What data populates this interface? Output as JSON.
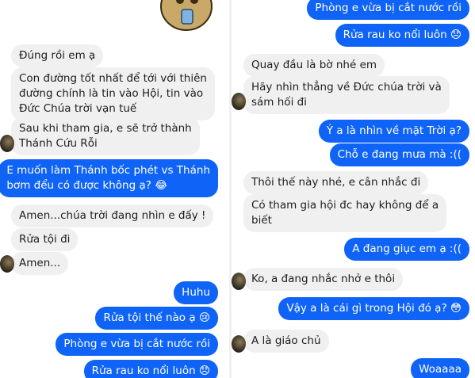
{
  "left": {
    "messages": [
      {
        "side": "in",
        "text": "Đúng rồi em ạ"
      },
      {
        "side": "in",
        "lines": [
          "Con đường tốt nhất để tới với thiên",
          "đường chính là tin vào Hội, tin vào",
          "Đức Chúa trời vạn tuế"
        ]
      },
      {
        "side": "in",
        "lines": [
          "Sau khi tham gia, e sẽ trở thành",
          "Thánh Cứu Rỗi"
        ]
      },
      {
        "side": "out",
        "lines": [
          "E muốn làm Thánh bốc phét vs Thánh",
          "bơm đểu có được không ạ? 😂"
        ]
      },
      {
        "side": "in",
        "text": "Amen...chúa trời đang nhìn e đấy !"
      },
      {
        "side": "in",
        "text": "Rửa tội đi"
      },
      {
        "side": "in",
        "text": "Amen..."
      },
      {
        "side": "out",
        "text": "Huhu"
      },
      {
        "side": "out",
        "text": "Rửa tội thế nào ạ 😢"
      },
      {
        "side": "out",
        "text": "Phòng e vừa bị cắt nước rồi"
      },
      {
        "side": "out",
        "text": "Rửa rau ko nổi luôn 😞"
      }
    ]
  },
  "right": {
    "messages": [
      {
        "side": "out",
        "text": "Phòng e vừa bị cắt nước rồi"
      },
      {
        "side": "out",
        "text": "Rửa rau ko nổi luôn 😞"
      },
      {
        "side": "in",
        "text": "Quay đầu là bờ nhé em"
      },
      {
        "side": "in",
        "lines": [
          "Hãy nhìn thẳng về Đức chúa trời và",
          "sám hối đi"
        ]
      },
      {
        "side": "out",
        "text": "Ý a là nhìn về mặt Trời ạ?"
      },
      {
        "side": "out",
        "text": "Chỗ e đang mưa mà :(("
      },
      {
        "side": "in",
        "text": "Thôi thế này nhé, e cân nhắc đi"
      },
      {
        "side": "in",
        "lines": [
          "Có tham gia hội đc hay không để a",
          "biết"
        ]
      },
      {
        "side": "out",
        "text": "A đang giục em ạ :(("
      },
      {
        "side": "in",
        "text": "Ko, a đang nhắc nhở e thôi"
      },
      {
        "side": "out",
        "text": "Vậy a là cái gì trong Hội đó ạ? 😳"
      },
      {
        "side": "in",
        "text": "A là giáo chủ"
      },
      {
        "side": "out",
        "text": "Woaaaa"
      }
    ]
  }
}
